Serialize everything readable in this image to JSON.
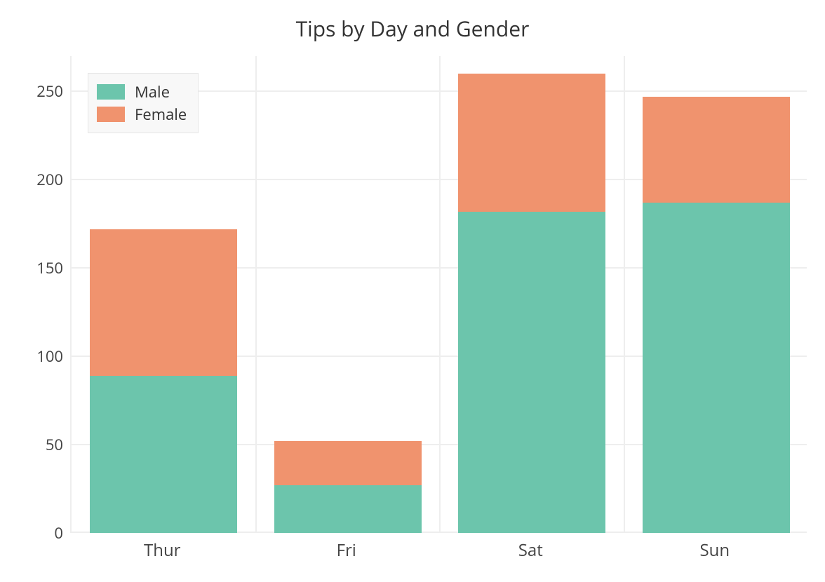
{
  "chart_data": {
    "type": "bar",
    "stacked": true,
    "title": "Tips by Day and Gender",
    "categories": [
      "Thur",
      "Fri",
      "Sat",
      "Sun"
    ],
    "series": [
      {
        "name": "Male",
        "color": "#6cc5ac",
        "values": [
          89,
          27,
          182,
          187
        ]
      },
      {
        "name": "Female",
        "color": "#f0936e",
        "values": [
          83,
          25,
          78,
          60
        ]
      }
    ],
    "xlabel": "",
    "ylabel": "",
    "ylim": [
      0,
      270
    ],
    "yticks": [
      0,
      50,
      100,
      150,
      200,
      250
    ],
    "grid": true,
    "legend_position": "top-left"
  }
}
